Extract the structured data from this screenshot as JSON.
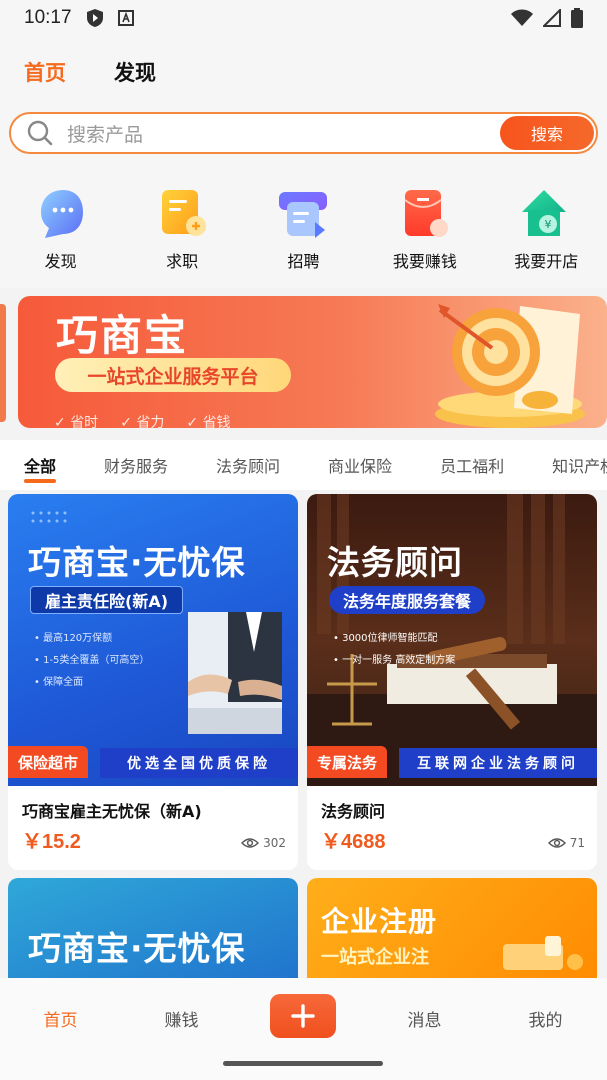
{
  "status_bar": {
    "time": "10:17"
  },
  "top_tabs": [
    {
      "label": "首页",
      "active": true
    },
    {
      "label": "发现",
      "active": false
    }
  ],
  "search": {
    "placeholder": "搜索产品",
    "button_label": "搜索"
  },
  "quick_actions": [
    {
      "label": "发现",
      "icon": "chat-bubble-icon"
    },
    {
      "label": "求职",
      "icon": "resume-icon"
    },
    {
      "label": "招聘",
      "icon": "recruit-icon"
    },
    {
      "label": "我要赚钱",
      "icon": "red-envelope-icon"
    },
    {
      "label": "我要开店",
      "icon": "shop-house-icon"
    }
  ],
  "banner": {
    "title": "巧商宝",
    "subtitle": "一站式企业服务平台",
    "tags": [
      "省时",
      "省力",
      "省钱"
    ]
  },
  "categories": [
    {
      "label": "全部",
      "active": true
    },
    {
      "label": "财务服务"
    },
    {
      "label": "法务顾问"
    },
    {
      "label": "商业保险"
    },
    {
      "label": "员工福利"
    },
    {
      "label": "知识产权"
    }
  ],
  "products": [
    {
      "image_title": "巧商宝·无忧保",
      "image_subtitle": "雇主责任险(新A)",
      "image_bullets": [
        "最高120万保额",
        "1-5类全覆盖（可高空）",
        "保障全面"
      ],
      "image_tag": "保险超市",
      "image_strip": "优选全国优质保险",
      "title": "巧商宝雇主无忧保（新A)",
      "price": "￥15.2",
      "views": "302"
    },
    {
      "image_title": "法务顾问",
      "image_subtitle": "法务年度服务套餐",
      "image_bullets": [
        "3000位律师智能匹配",
        "一对一服务 高效定制方案"
      ],
      "image_tag": "专属法务",
      "image_strip": "互联网企业法务顾问",
      "title": "法务顾问",
      "price": "￥4688",
      "views": "71"
    },
    {
      "image_title": "巧商宝·无忧保"
    },
    {
      "image_title": "企业注册",
      "image_subtitle": "一站式企业注"
    }
  ],
  "bottom_nav": [
    {
      "label": "首页",
      "active": true
    },
    {
      "label": "赚钱"
    },
    {
      "label": "消息"
    },
    {
      "label": "我的"
    }
  ],
  "colors": {
    "accent": "#f56a1d",
    "price": "#f05a1e",
    "insurance_blue": "#1e58d6",
    "legal_brown": "#5a2e1a"
  }
}
